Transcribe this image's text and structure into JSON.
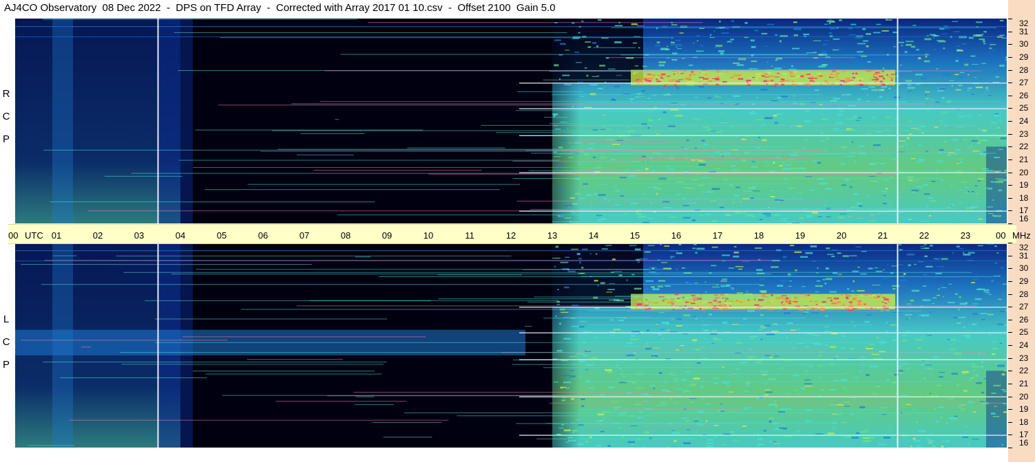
{
  "title": "AJ4CO Observatory  08 Dec 2022  -  DPS on TFD Array  -  Corrected with Array 2017 01 10.csv  -  Offset 2100  Gain 5.0",
  "colors": {
    "background_dark": "#000010",
    "low": "#0a2a8c",
    "mid": "#1e7ad0",
    "high": "#4fe0d8",
    "peak": "#d8f040",
    "burst": "#ff2d6e",
    "time_axis_bg": "#ffffc8",
    "freq_axis_bg": "#fadcc2"
  },
  "chart_data": {
    "type": "heatmap",
    "x_axis": {
      "unit": "UTC",
      "range_hours": [
        0,
        24
      ],
      "tick_labels": [
        "00",
        "01",
        "02",
        "03",
        "04",
        "05",
        "06",
        "07",
        "08",
        "09",
        "10",
        "11",
        "12",
        "13",
        "14",
        "15",
        "16",
        "17",
        "18",
        "19",
        "20",
        "21",
        "22",
        "23",
        "00"
      ]
    },
    "y_axis": {
      "unit": "MHz",
      "range": [
        16,
        32
      ],
      "tick_labels": [
        "32",
        "31",
        "30",
        "29",
        "28",
        "27",
        "26",
        "25",
        "24",
        "23",
        "22",
        "21",
        "20",
        "19",
        "18",
        "17",
        "16"
      ]
    },
    "panels": [
      {
        "polarization": "R C P",
        "bright_region_utc": [
          13.0,
          24.0
        ],
        "peak_band_mhz": [
          26.8,
          28.0
        ],
        "vertical_lines_utc": [
          3.45,
          21.35
        ],
        "strong_horizontal_lines_mhz": [
          27.0,
          25.0,
          22.9,
          20.0,
          17.0
        ]
      },
      {
        "polarization": "L C P",
        "bright_region_utc": [
          13.0,
          24.0
        ],
        "peak_band_mhz": [
          26.8,
          28.0
        ],
        "vertical_lines_utc": [
          3.45,
          21.35
        ],
        "strong_horizontal_lines_mhz": [
          27.0,
          25.0,
          22.9,
          20.0,
          17.0
        ],
        "diffuse_band_mhz": [
          23.2,
          25.2
        ],
        "diffuse_band_utc": [
          0,
          12.35
        ]
      }
    ]
  }
}
